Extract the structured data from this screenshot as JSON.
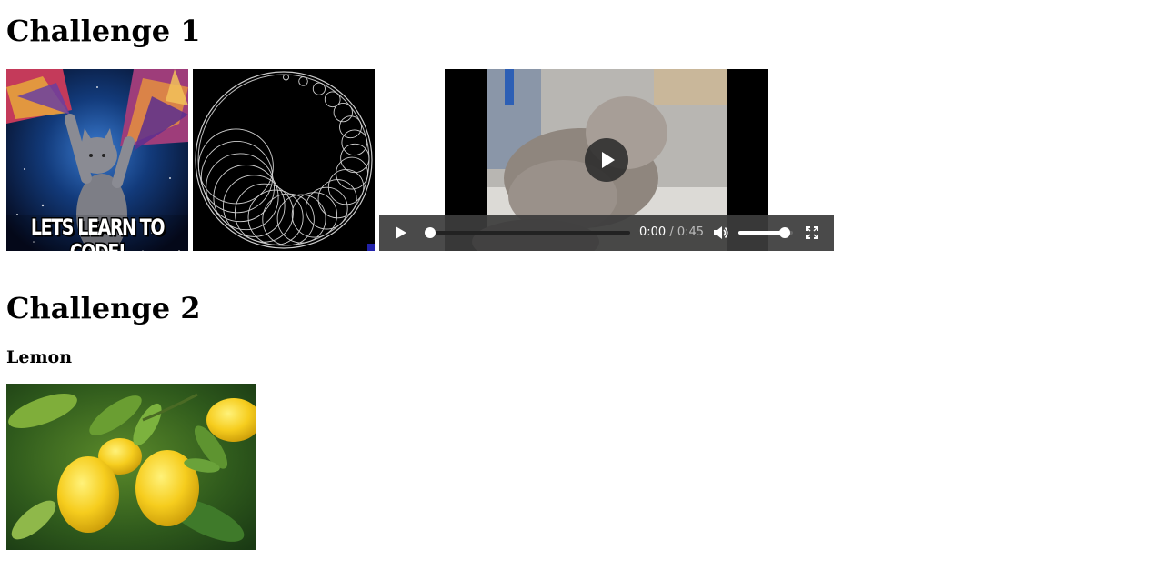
{
  "challenge1": {
    "heading": "Challenge 1",
    "meme_caption": "LETS LEARN TO CODE!",
    "video": {
      "current_time": "0:00",
      "duration": "/ 0:45",
      "progress": 0,
      "volume": 0.85
    }
  },
  "challenge2": {
    "heading": "Challenge 2",
    "subheading": "Lemon"
  }
}
